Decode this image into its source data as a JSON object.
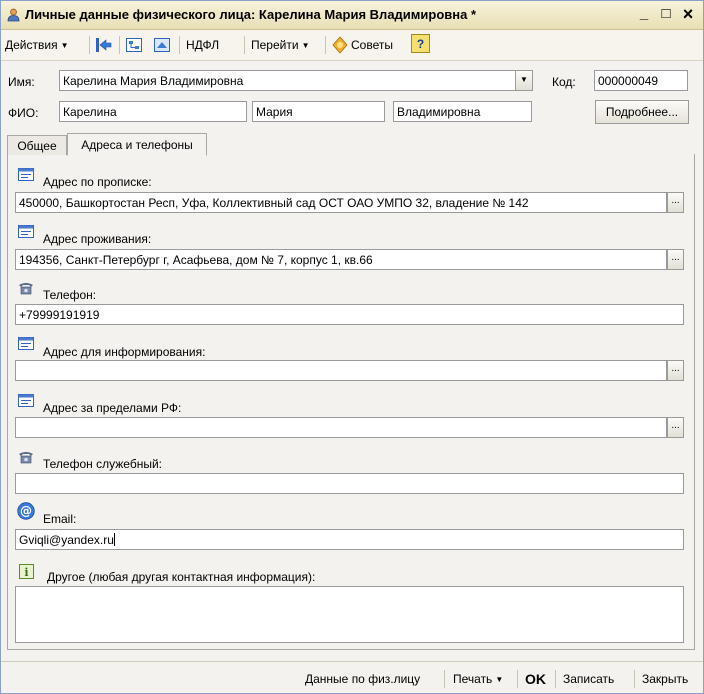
{
  "window": {
    "title": "Личные данные физического лица: Карелина Мария Владимировна *",
    "minimize_glyph": "_",
    "maximize_glyph": "□",
    "close_glyph": "×"
  },
  "toolbar": {
    "actions_label": "Действия",
    "ndfl_label": "НДФЛ",
    "goto_label": "Перейти",
    "tips_label": "Советы",
    "help_label": "?"
  },
  "header": {
    "name_label": "Имя:",
    "name_value": "Карелина Мария Владимировна",
    "code_label": "Код:",
    "code_value": "000000049",
    "fio_label": "ФИО:",
    "last_name": "Карелина",
    "first_name": "Мария",
    "middle_name": "Владимировна",
    "details_button": "Подробнее..."
  },
  "tabs": [
    {
      "label": "Общее",
      "active": false
    },
    {
      "label": "Адреса и телефоны",
      "active": true
    }
  ],
  "fields": {
    "reg_address": {
      "label": "Адрес по прописке:",
      "value": "450000, Башкортостан Респ, Уфа, Коллективный сад ОСТ ОАО УМПО 32, владение № 142",
      "icon": "address-card-icon"
    },
    "live_address": {
      "label": "Адрес проживания:",
      "value": "194356, Санкт-Петербург г, Асафьева, дом № 7, корпус 1, кв.66",
      "icon": "address-card-icon"
    },
    "phone": {
      "label": "Телефон:",
      "value": "+79999191919",
      "icon": "telephone-icon"
    },
    "info_address": {
      "label": "Адрес для информирования:",
      "value": "",
      "icon": "address-card-icon"
    },
    "foreign_address": {
      "label": "Адрес за пределами РФ:",
      "value": "",
      "icon": "address-card-icon"
    },
    "work_phone": {
      "label": "Телефон служебный:",
      "value": "",
      "icon": "telephone-icon"
    },
    "email": {
      "label": "Email:",
      "value": "Gviqli@yandex.ru",
      "icon": "email-at-icon"
    },
    "other": {
      "label": "Другое (любая другая контактная информация):",
      "value": "",
      "icon": "info-note-icon"
    }
  },
  "select_button": "...",
  "statusbar": {
    "person_data": "Данные по физ.лицу",
    "print": "Печать",
    "ok": "OK",
    "save": "Записать",
    "close": "Закрыть"
  },
  "colors": {
    "title_gradient_top": "#f7f3dc",
    "title_gradient_bottom": "#e8dfb4",
    "window_bg": "#f3f2ee",
    "field_border": "#9a9a9a"
  }
}
